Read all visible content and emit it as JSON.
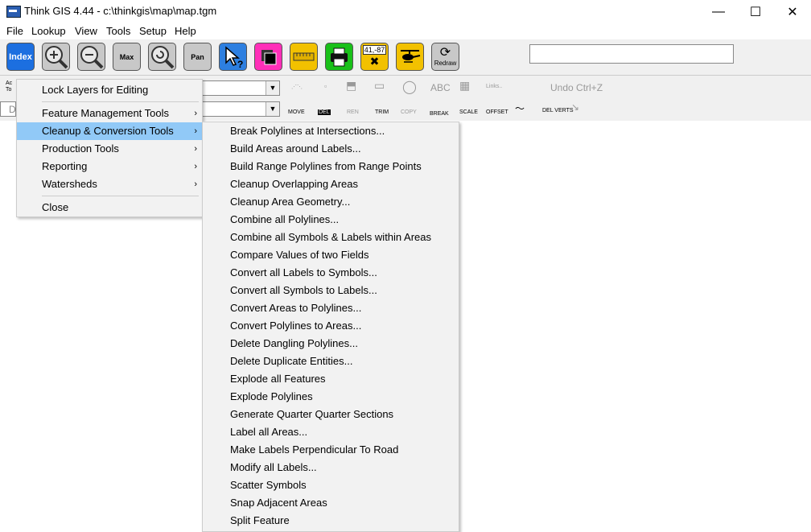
{
  "window": {
    "title": "Think GIS 4.44 - c:\\thinkgis\\map\\map.tgm",
    "minimize": "—",
    "maximize": "☐",
    "close": "✕"
  },
  "menubar": [
    "File",
    "Lookup",
    "View",
    "Tools",
    "Setup",
    "Help"
  ],
  "toolbar": {
    "index_label": "Index",
    "max_label": "Max",
    "pan_label": "Pan",
    "coords_label": "41,-87",
    "redraw_label": "Redraw",
    "search_value": ""
  },
  "editbar": {
    "left_labels": [
      "Ac",
      "To",
      "D"
    ],
    "tools_row1": [
      "",
      "",
      "",
      "",
      "",
      "ABC",
      "",
      "Links..",
      "Undo  Ctrl+Z"
    ],
    "tools_row2": [
      "MOVE",
      "DEL",
      "REN",
      "TRIM",
      "COPY",
      "BREAK",
      "SCALE",
      "OFFSET",
      "",
      "DEL VERTS",
      ""
    ]
  },
  "menu1": {
    "items": [
      {
        "label": "Lock Layers for Editing",
        "submenu": false
      },
      {
        "label": "Feature Management Tools",
        "submenu": true
      },
      {
        "label": "Cleanup & Conversion Tools",
        "submenu": true,
        "selected": true
      },
      {
        "label": "Production Tools",
        "submenu": true
      },
      {
        "label": "Reporting",
        "submenu": true
      },
      {
        "label": "Watersheds",
        "submenu": true
      },
      {
        "label": "Close",
        "submenu": false
      }
    ]
  },
  "menu2": {
    "items": [
      "Break Polylines at Intersections...",
      "Build Areas around Labels...",
      "Build Range Polylines from Range Points",
      "Cleanup Overlapping Areas",
      "Cleanup Area Geometry...",
      "Combine all Polylines...",
      "Combine all Symbols & Labels within Areas",
      "Compare Values of two Fields",
      "Convert all Labels to Symbols...",
      "Convert all Symbols to Labels...",
      "Convert Areas to Polylines...",
      "Convert Polylines to Areas...",
      "Delete Dangling Polylines...",
      "Delete Duplicate Entities...",
      "Explode all Features",
      "Explode Polylines",
      "Generate Quarter Quarter Sections",
      "Label all Areas...",
      "Make Labels Perpendicular To Road",
      "Modify all Labels...",
      "Scatter Symbols",
      "Snap Adjacent Areas",
      "Split Feature"
    ]
  },
  "chevron": "›",
  "colors": {
    "menu_highlight": "#91c9f7",
    "menu_bg": "#f2f2f2",
    "index_blue": "#1c6fe0"
  }
}
